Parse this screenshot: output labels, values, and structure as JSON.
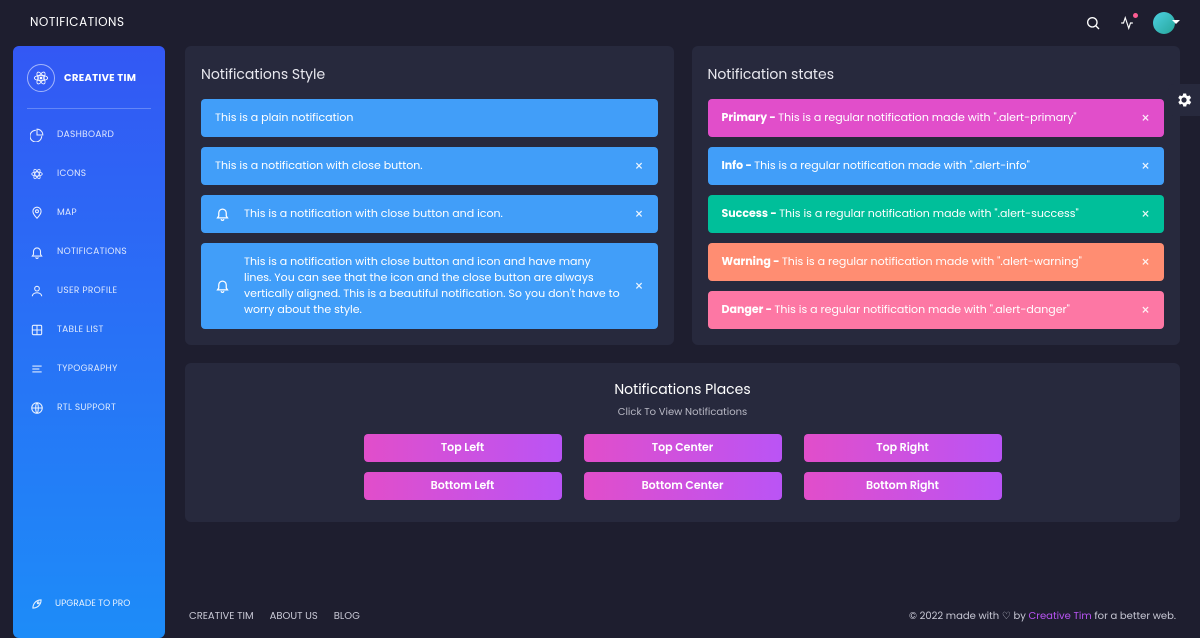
{
  "header": {
    "title": "NOTIFICATIONS"
  },
  "sidebar": {
    "brand": "CREATIVE TIM",
    "items": [
      {
        "label": "DASHBOARD"
      },
      {
        "label": "ICONS"
      },
      {
        "label": "MAP"
      },
      {
        "label": "NOTIFICATIONS"
      },
      {
        "label": "USER PROFILE"
      },
      {
        "label": "TABLE LIST"
      },
      {
        "label": "TYPOGRAPHY"
      },
      {
        "label": "RTL SUPPORT"
      }
    ],
    "upgrade": "UPGRADE TO PRO"
  },
  "styleCard": {
    "title": "Notifications Style",
    "alerts": [
      {
        "text": "This is a plain notification"
      },
      {
        "text": "This is a notification with close button."
      },
      {
        "text": "This is a notification with close button and icon."
      },
      {
        "text": "This is a notification with close button and icon and have many lines. You can see that the icon and the close button are always vertically aligned. This is a beautiful notification. So you don't have to worry about the style."
      }
    ]
  },
  "statesCard": {
    "title": "Notification states",
    "alerts": [
      {
        "strong": "Primary - ",
        "text": "This is a regular notification made with \".alert-primary\""
      },
      {
        "strong": "Info - ",
        "text": "This is a regular notification made with \".alert-info\""
      },
      {
        "strong": "Success - ",
        "text": "This is a regular notification made with \".alert-success\""
      },
      {
        "strong": "Warning - ",
        "text": "This is a regular notification made with \".alert-warning\""
      },
      {
        "strong": "Danger - ",
        "text": "This is a regular notification made with \".alert-danger\""
      }
    ]
  },
  "places": {
    "title": "Notifications Places",
    "subtitle": "Click To View Notifications",
    "buttons": [
      "Top Left",
      "Top Center",
      "Top Right",
      "Bottom Left",
      "Bottom Center",
      "Bottom Right"
    ]
  },
  "footer": {
    "links": [
      "CREATIVE TIM",
      "ABOUT US",
      "BLOG"
    ],
    "copy_pre": "© 2022 made with ♡ by ",
    "copy_link": "Creative Tim",
    "copy_post": " for a better web."
  }
}
